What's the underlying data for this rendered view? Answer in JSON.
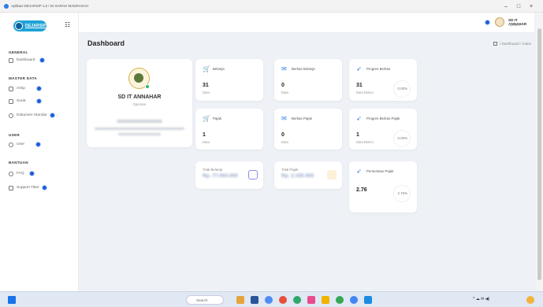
{
  "window": {
    "tab_title": "Aplikasi DEJARSIP 1.0 / ID SARAH MADRASAH",
    "minimize": "–",
    "maximize": "□",
    "close": "×"
  },
  "sidebar": {
    "logo_text": "DEJARSIP",
    "menu_toggle": "☷",
    "sections": {
      "general": "GENERAL",
      "master_data": "MASTER DATA",
      "user": "USER",
      "bantuan": "BANTUAN"
    },
    "items": [
      {
        "label": "Dashboard",
        "icon": "home-icon"
      },
      {
        "label": "Arsip",
        "icon": "folder-icon"
      },
      {
        "label": "Surat",
        "icon": "mail-icon"
      },
      {
        "label": "Dokumen Standar",
        "icon": "document-icon"
      },
      {
        "label": "User",
        "icon": "user-icon"
      },
      {
        "label": "FAQ",
        "icon": "question-icon"
      },
      {
        "label": "Support Tiket",
        "icon": "ticket-icon"
      }
    ]
  },
  "header": {
    "user_name": "SD IT ANNAHAR",
    "user_role": "Operator"
  },
  "page": {
    "title": "Dashboard",
    "breadcrumb": "/ Dashboard / Index"
  },
  "profile": {
    "name": "SD IT ANNAHAR",
    "role": "Operator"
  },
  "cards": {
    "belanja": {
      "label": "Belanja",
      "value": "31",
      "sub": "Data"
    },
    "berkas_belanja": {
      "label": "Berkas Belanja",
      "value": "0",
      "sub": "Data"
    },
    "progres_berkas": {
      "label": "Progres Berkas",
      "value": "31",
      "sub": "Data Belum",
      "pct": "0.00%"
    },
    "pajak": {
      "label": "Pajak",
      "value": "1",
      "sub": "Data"
    },
    "berkas_pajak": {
      "label": "Berkas Pajak",
      "value": "0",
      "sub": "Data"
    },
    "progres_berkas_pajak": {
      "label": "Progres Berkas Pajak",
      "value": "1",
      "sub": "Data Belum",
      "pct": "0.00%"
    },
    "total_belanja": {
      "label": "Total Belanja",
      "value": "Rp. 77.004.000"
    },
    "total_pajak": {
      "label": "Total Pajak",
      "value": "Rp. 2.155.000"
    },
    "persentase_pajak": {
      "label": "Persentase Pajak",
      "value": "2.76",
      "pct": "2.76%"
    }
  },
  "taskbar": {
    "search_label": "Search",
    "tray_text": "^ ☁ ✉ ◀)"
  },
  "colors": {
    "accent": "#1a5bd8",
    "sidebar_bg": "#ffffff",
    "page_bg": "#eef1f6"
  }
}
